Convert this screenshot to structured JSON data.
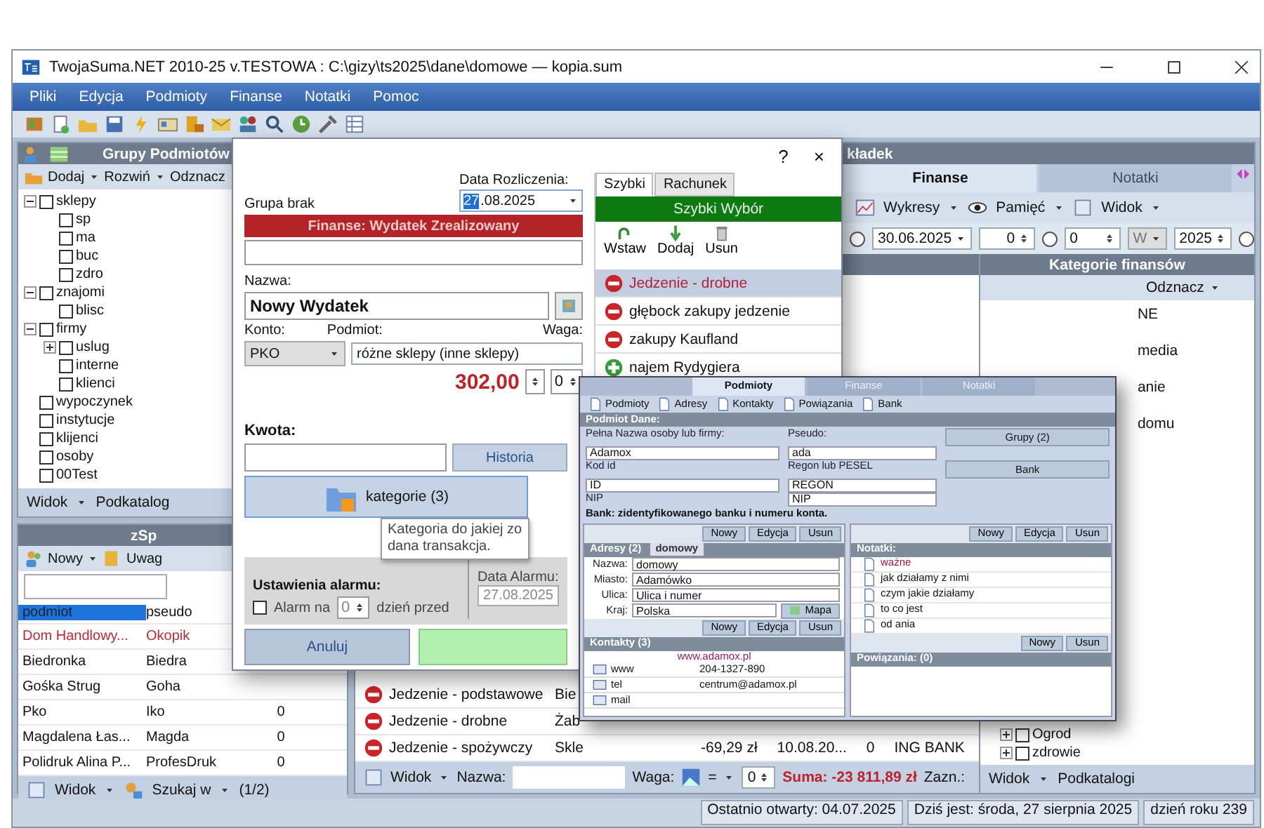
{
  "window": {
    "title": "TwojaSuma.NET 2010-25 v.TESTOWA : C:\\gizy\\ts2025\\dane\\domowe — kopia.sum"
  },
  "menu": [
    "Pliki",
    "Edycja",
    "Podmioty",
    "Finanse",
    "Notatki",
    "Pomoc"
  ],
  "groups_panel": {
    "title": "Grupy Podmiotów",
    "toolbar": [
      "Dodaj",
      "Rozwiń",
      "Odznacz"
    ],
    "tree": [
      {
        "label": "sklepy",
        "checked": false,
        "expanded": true,
        "children": [
          {
            "label": "sp",
            "checked": false
          },
          {
            "label": "ma",
            "checked": false
          },
          {
            "label": "buc",
            "checked": false
          },
          {
            "label": "zdro",
            "checked": false
          }
        ]
      },
      {
        "label": "znajomi",
        "checked": false,
        "expanded": true,
        "children": [
          {
            "label": "blisc",
            "checked": false
          }
        ]
      },
      {
        "label": "firmy",
        "checked": false,
        "expanded": true,
        "children": [
          {
            "label": "uslug",
            "checked": false,
            "expanded": false
          },
          {
            "label": "interne",
            "checked": false
          },
          {
            "label": "klienci",
            "checked": false
          }
        ]
      },
      {
        "label": "wypoczynek",
        "checked": false
      },
      {
        "label": "instytucje",
        "checked": false
      },
      {
        "label": "klijenci",
        "checked": false
      },
      {
        "label": "osoby",
        "checked": false
      },
      {
        "label": "00Test",
        "checked": false
      }
    ],
    "footer": [
      "Widok",
      "Podkatalog"
    ]
  },
  "contacts_panel": {
    "title": "zSp",
    "toolbar": [
      "Nowy",
      "Uwag"
    ],
    "columns": [
      {
        "label": "podmiot",
        "selected": true
      },
      {
        "label": "pseudo",
        "selected": false
      }
    ],
    "rows": [
      {
        "cells": [
          "Dom Handlowy...",
          "Okopik"
        ],
        "flagged": true
      },
      {
        "cells": [
          "Biedronka",
          "Biedra"
        ],
        "flagged": false
      },
      {
        "cells": [
          "Gośka Strug",
          "Goha"
        ],
        "flagged": false
      },
      {
        "cells": [
          "Pko",
          "Iko",
          "0"
        ],
        "flagged": false
      },
      {
        "cells": [
          "Magdalena Łas...",
          "Magda",
          "0"
        ],
        "flagged": false
      },
      {
        "cells": [
          "Polidruk Alina P...",
          "ProfesDruk",
          "0"
        ],
        "flagged": false
      }
    ],
    "footer": [
      "Widok",
      "Szukaj w",
      "(1/2)"
    ]
  },
  "main_tabs": {
    "title": "kładek",
    "tabs": [
      {
        "label": "Finanse",
        "selected": true
      },
      {
        "label": "Notatki",
        "selected": false
      }
    ],
    "toolbar": [
      "Wykresy",
      "Pamięć",
      "Widok"
    ],
    "date_filter": {
      "date": "30.06.2025",
      "spin_1": "0",
      "spin_2": "0",
      "combo": "W",
      "year": "2025",
      "radios": [
        {
          "selected": false
        },
        {
          "selected": false
        },
        {
          "selected": false
        }
      ]
    },
    "transactions": [
      {
        "kind": "expense",
        "name": "Jedzenie - podstawowe",
        "cells": [
          "Bie"
        ]
      },
      {
        "kind": "expense",
        "name": "Jedzenie - drobne",
        "cells": [
          "Żab"
        ]
      },
      {
        "kind": "expense",
        "name": "Jedzenie - spożywczy",
        "cells": [
          "Skle",
          "-69,29 zł",
          "10.08.20...",
          "0",
          "ING BANK"
        ]
      }
    ],
    "footer": {
      "view": "Widok",
      "name_label": "Nazwa:",
      "weight_label": "Waga:",
      "operator": "=",
      "weight": "0",
      "sum": "Suma: -23 811,89 zł",
      "selected_label": "Zazn.:"
    }
  },
  "categories_panel": {
    "title": "Kategorie finansów",
    "toolbar": [
      "Odznacz"
    ],
    "cut_labels": [
      "NE",
      "media",
      "anie",
      "domu"
    ],
    "tree": [
      {
        "label": "Ogrod",
        "checked": false,
        "expanded": false
      },
      {
        "label": "zdrowie",
        "checked": false,
        "expanded": false
      }
    ],
    "footer": [
      "Widok",
      "Podkatalogi"
    ]
  },
  "status_bar": [
    "Ostatnio otwarty: 04.07.2025",
    "Dziś jest: środa, 27 sierpnia 2025",
    "dzień roku 239"
  ],
  "expense_dialog": {
    "help": "?",
    "close": "×",
    "group": "Grupa brak",
    "title": "Finanse: Wydatek Zrealizowany",
    "date_label": "Data Rozliczenia:",
    "date_day": "27",
    "date_rest": ".08.2025",
    "name_label": "Nazwa:",
    "name": "Nowy Wydatek",
    "account_label": "Konto:",
    "payee_label": "Podmiot:",
    "weight_label": "Waga:",
    "account": "PKO",
    "payee": "różne sklepy (inne sklepy)",
    "amount": "302,00",
    "weight": "0",
    "amount_label": "Kwota:",
    "history_button": "Historia",
    "tooltip": [
      "Kategoria do jakiej zo",
      "dana transakcja."
    ],
    "category_button": "kategorie (3)",
    "alarm_date_label": "Data Alarmu:",
    "alarm_date": "27.08.2025",
    "alarm_title": "Ustawienia alarmu:",
    "alarm": {
      "label": "Alarm na",
      "checked": false,
      "days": "0",
      "suffix": "dzień przed"
    },
    "cancel_button": "Anuluj",
    "side": {
      "tabs": [
        {
          "label": "Szybki",
          "selected": true
        },
        {
          "label": "Rachunek",
          "selected": false
        }
      ],
      "title": "Szybki Wybór",
      "tools": [
        "Wstaw",
        "Dodaj",
        "Usun"
      ],
      "items": [
        {
          "label": "Jedzenie - drobne",
          "kind": "expense",
          "selected": true
        },
        {
          "label": "głębock zakupy jedzenie",
          "kind": "expense",
          "selected": false
        },
        {
          "label": "zakupy Kaufland",
          "kind": "expense",
          "selected": false
        },
        {
          "label": "najem Rydygiera",
          "kind": "income",
          "selected": false
        }
      ]
    }
  },
  "contact_window": {
    "tabs": [
      {
        "label": "Podmioty",
        "selected": true
      },
      {
        "label": "Finanse",
        "selected": false
      },
      {
        "label": "Notatki",
        "selected": false
      }
    ],
    "toolbar": [
      "Podmioty",
      "Adresy",
      "Kontakty",
      "Powiązania",
      "Bank"
    ],
    "details": {
      "title": "Podmiot Dane:",
      "full_name_label": "Pełna Nazwa osoby lub firmy:",
      "full_name": "Adamox",
      "pseudo_label": "Pseudo:",
      "pseudo": "ada",
      "groups_button": "Grupy (2)",
      "regon_label": "Regon lub PESEL",
      "regon": "REGON",
      "bank_button": "Bank",
      "id_label": "Kod id",
      "id": "ID",
      "nip_label": "NIP",
      "nip": "NIP",
      "bank_note": "Bank: zidentyfikowanego banku i numeru konta."
    },
    "addresses": {
      "title": "Adresy (2)",
      "type": "domowy",
      "buttons": [
        "Nowy",
        "Edycja",
        "Usun"
      ],
      "fields": [
        {
          "label": "Nazwa:",
          "value": "domowy"
        },
        {
          "label": "Miasto:",
          "value": "Adamówko"
        },
        {
          "label": "Ulica:",
          "value": "Ulica i numer"
        },
        {
          "label": "Kraj:",
          "value": "Polska"
        }
      ],
      "map_button": "Mapa"
    },
    "contacts": {
      "title": "Kontakty (3)",
      "buttons": [
        "Nowy",
        "Edycja",
        "Usun"
      ],
      "link": "www.adamox.pl",
      "rows": [
        {
          "type": "www",
          "value": "204-1327-890"
        },
        {
          "type": "tel",
          "value": "centrum@adamox.pl"
        },
        {
          "type": "mail"
        }
      ]
    },
    "notes": {
      "title": "Notatki:",
      "buttons": [
        "Nowy",
        "Edycja",
        "Usun"
      ],
      "items": [
        {
          "label": "ważne",
          "important": true
        },
        {
          "label": "jak działamy z nimi",
          "important": false
        },
        {
          "label": "czym jakie działamy",
          "important": false
        },
        {
          "label": "to co jest",
          "important": false
        },
        {
          "label": "od ania",
          "important": false
        }
      ]
    },
    "relations": {
      "title": "Powiązania: (0)",
      "buttons": [
        "Nowy",
        "Usun"
      ]
    }
  }
}
